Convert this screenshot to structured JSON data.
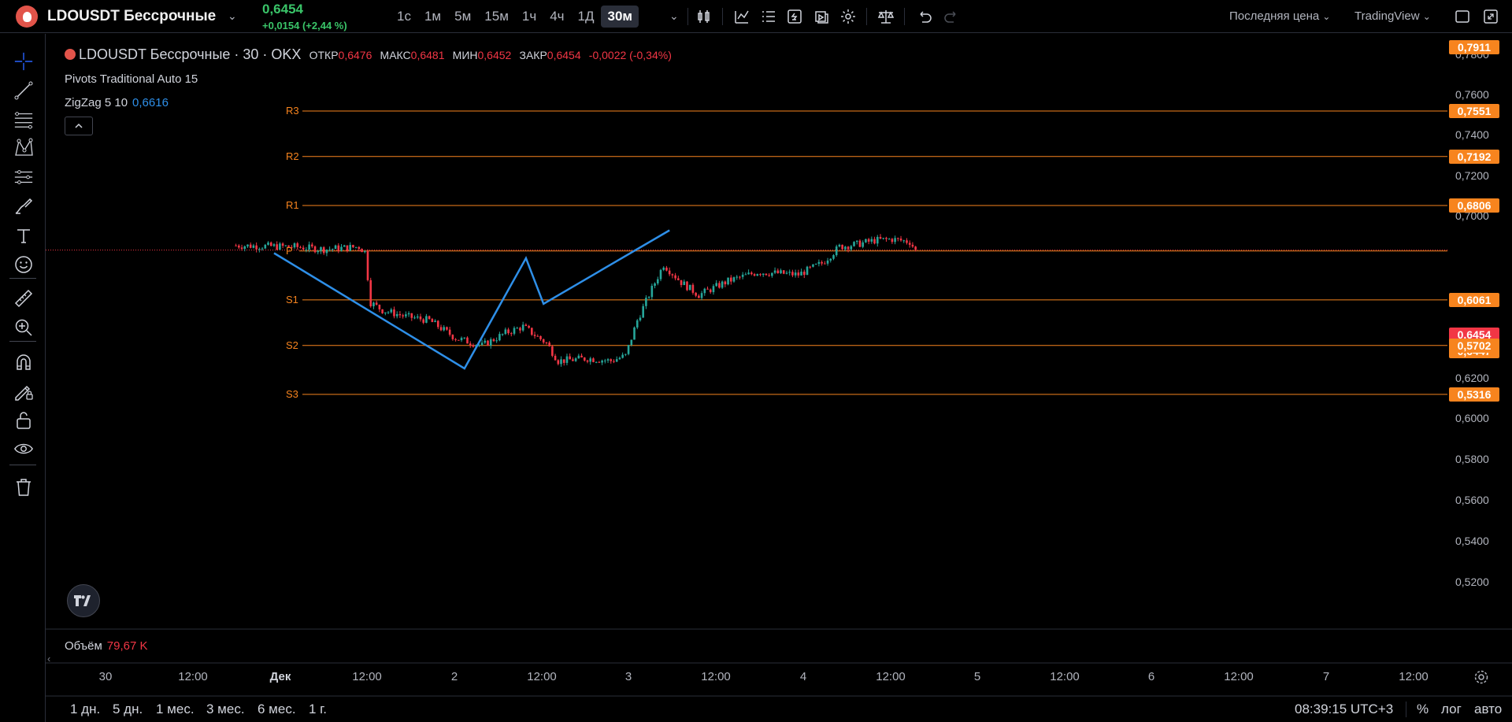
{
  "header": {
    "symbol": "LDOUSDT Бессрочные",
    "last_price": "0,6454",
    "change": "+0,0154 (+2,44 %)",
    "intervals": [
      "1с",
      "1м",
      "5м",
      "15м",
      "1ч",
      "4ч",
      "1Д",
      "30м"
    ],
    "active_interval": "30м",
    "price_type": "Последняя цена",
    "provider": "TradingView"
  },
  "legend": {
    "symbol": "LDOUSDT Бессрочные · 30 · OKX",
    "open_label": "ОТКР",
    "open": "0,6476",
    "high_label": "МАКС",
    "high": "0,6481",
    "low_label": "МИН",
    "low": "0,6452",
    "close_label": "ЗАКР",
    "close": "0,6454",
    "change": "-0,0022 (-0,34%)"
  },
  "indicators": {
    "pivots": "Pivots Traditional Auto 15",
    "zigzag": "ZigZag 5 10",
    "zigzag_value": "0,6616"
  },
  "price_axis": {
    "ticks": [
      "0,7800",
      "0,7600",
      "0,7400",
      "0,7200",
      "0,7000",
      "0,6600",
      "0,6200",
      "0,6000",
      "0,5800",
      "0,5600",
      "0,5400",
      "0,5200"
    ],
    "badges": [
      {
        "label": "0,7911",
        "price": 0.7911
      },
      {
        "label": "0,7551",
        "price": 0.7551
      },
      {
        "label": "0,7192",
        "price": 0.7192
      },
      {
        "label": "0,6806",
        "price": 0.6806
      },
      {
        "label": "0,6454",
        "price": 0.6454,
        "current": true
      },
      {
        "label": "0,6447",
        "price": 0.6447
      },
      {
        "label": "0,6061",
        "price": 0.6061
      },
      {
        "label": "0,5702",
        "price": 0.5702
      },
      {
        "label": "0,5316",
        "price": 0.5316
      }
    ]
  },
  "pivots": [
    {
      "label": "R3",
      "price": 0.7551
    },
    {
      "label": "R2",
      "price": 0.7192
    },
    {
      "label": "R1",
      "price": 0.6806
    },
    {
      "label": "P",
      "price": 0.6447
    },
    {
      "label": "S1",
      "price": 0.6061
    },
    {
      "label": "S2",
      "price": 0.5702
    },
    {
      "label": "S3",
      "price": 0.5316
    }
  ],
  "time_axis": [
    "30",
    "12:00",
    "Дек",
    "12:00",
    "2",
    "12:00",
    "3",
    "12:00",
    "4",
    "12:00",
    "5",
    "12:00",
    "6",
    "12:00",
    "7",
    "12:00"
  ],
  "volume": {
    "label": "Объём",
    "value": "79,67 K"
  },
  "bottom": {
    "ranges": [
      "1 дн.",
      "5 дн.",
      "1 мес.",
      "3 мес.",
      "6 мес.",
      "1 г."
    ],
    "clock": "08:39:15 UTC+3",
    "percent": "%",
    "log": "лог",
    "auto": "авто"
  },
  "colors": {
    "up": "#26a69a",
    "down": "#f23645",
    "pivot": "#f7841e",
    "zigzag": "#2e8fe8",
    "accent_green": "#3ac569"
  },
  "chart_data": {
    "type": "candlestick",
    "symbol": "LDOUSDT Бессрочные",
    "interval": "30м",
    "ylim": [
      0.51,
      0.795
    ],
    "y_ticks": [
      0.52,
      0.54,
      0.56,
      0.58,
      0.6,
      0.62,
      0.66,
      0.7,
      0.72,
      0.74,
      0.76,
      0.78
    ],
    "close_path": [
      [
        -20,
        0.649
      ],
      [
        0,
        0.648
      ],
      [
        10,
        0.646
      ],
      [
        22,
        0.648
      ],
      [
        24,
        0.644
      ],
      [
        26,
        0.604
      ],
      [
        30,
        0.598
      ],
      [
        38,
        0.593
      ],
      [
        46,
        0.59
      ],
      [
        55,
        0.576
      ],
      [
        64,
        0.57
      ],
      [
        72,
        0.58
      ],
      [
        78,
        0.585
      ],
      [
        86,
        0.572
      ],
      [
        90,
        0.558
      ],
      [
        100,
        0.56
      ],
      [
        108,
        0.558
      ],
      [
        113,
        0.562
      ],
      [
        117,
        0.59
      ],
      [
        121,
        0.61
      ],
      [
        126,
        0.634
      ],
      [
        132,
        0.62
      ],
      [
        138,
        0.61
      ],
      [
        148,
        0.621
      ],
      [
        158,
        0.628
      ],
      [
        166,
        0.627
      ],
      [
        172,
        0.626
      ],
      [
        180,
        0.635
      ],
      [
        186,
        0.648
      ],
      [
        192,
        0.65
      ],
      [
        198,
        0.653
      ],
      [
        204,
        0.654
      ],
      [
        210,
        0.652
      ],
      [
        212,
        0.6454
      ]
    ],
    "zigzag": [
      [
        -7,
        0.643
      ],
      [
        58,
        0.552
      ],
      [
        79,
        0.639
      ],
      [
        85,
        0.603
      ],
      [
        128,
        0.661
      ]
    ],
    "last_close": 0.6454
  }
}
